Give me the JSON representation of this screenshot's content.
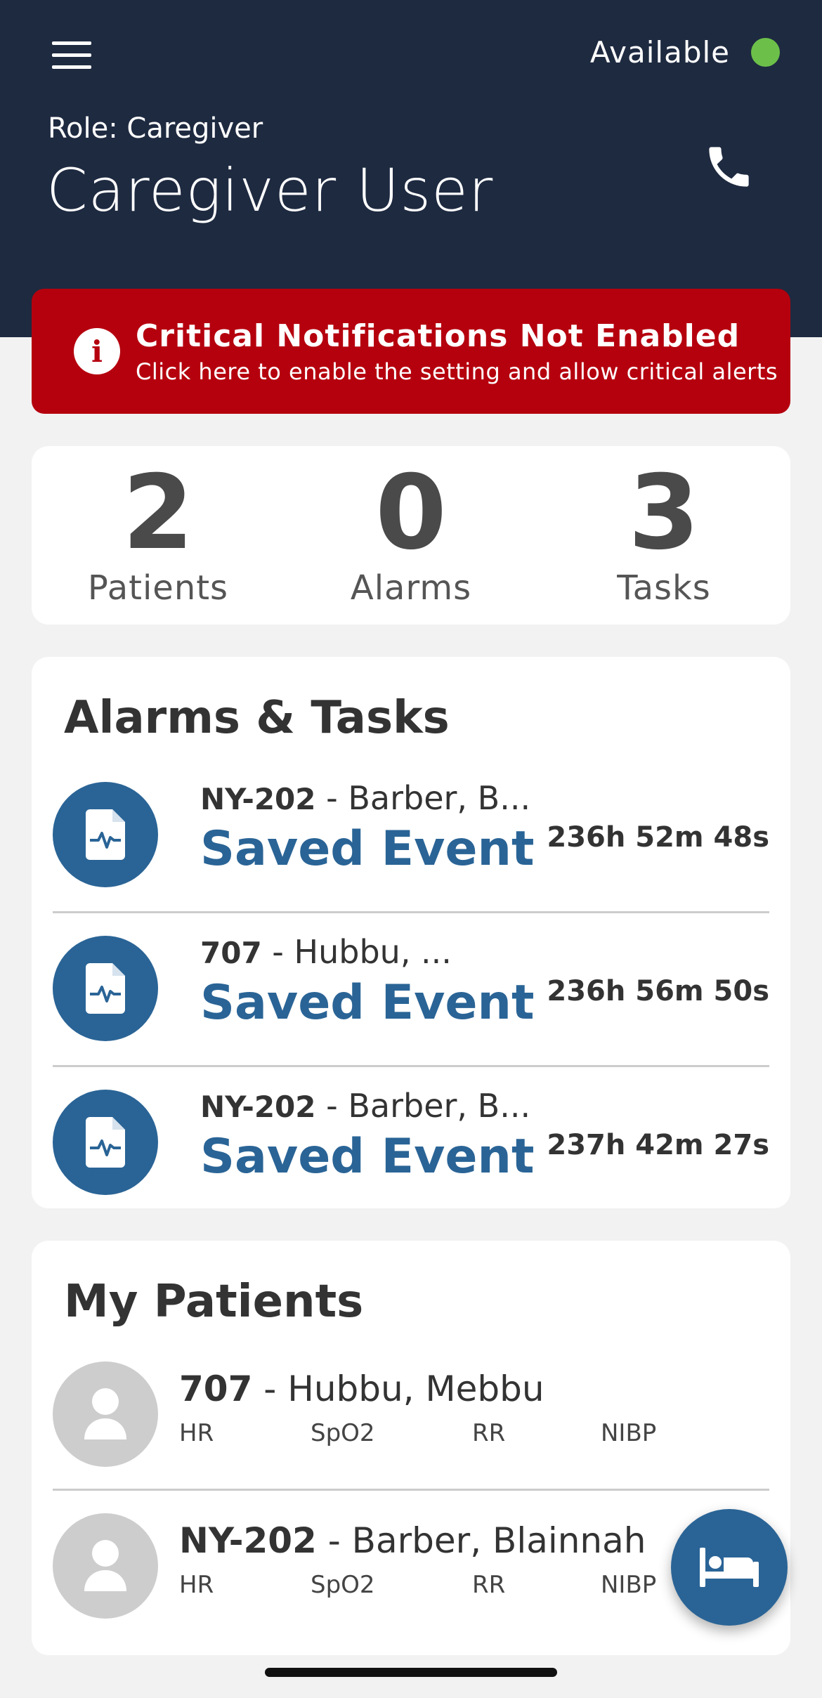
{
  "header": {
    "availability_label": "Available",
    "availability_color": "#6cc04a",
    "role_label": "Role: Caregiver",
    "user_name": "Caregiver User",
    "menu_icon": "hamburger-menu-icon",
    "call_icon": "phone-icon"
  },
  "critical_banner": {
    "title": "Critical Notifications Not Enabled",
    "subtitle": "Click here to enable the setting and allow critical alerts",
    "icon": "info-icon",
    "color": "#b5000e"
  },
  "summary": [
    {
      "value": "2",
      "label": "Patients"
    },
    {
      "value": "0",
      "label": "Alarms"
    },
    {
      "value": "3",
      "label": "Tasks"
    }
  ],
  "alarms_tasks": {
    "title": "Alarms & Tasks",
    "items": [
      {
        "room": "NY-202",
        "separator": " - ",
        "patient": "Barber, B...",
        "event": "Saved Event",
        "elapsed": "236h 52m 48s"
      },
      {
        "room": "707",
        "separator": " - ",
        "patient": "Hubbu, ...",
        "event": "Saved Event",
        "elapsed": "236h 56m 50s"
      },
      {
        "room": "NY-202",
        "separator": " - ",
        "patient": "Barber, B...",
        "event": "Saved Event",
        "elapsed": "237h 42m 27s"
      }
    ]
  },
  "my_patients": {
    "title": "My Patients",
    "items": [
      {
        "room": "707",
        "separator": " - ",
        "name": "Hubbu, Mebbu",
        "vitals": [
          "HR",
          "SpO2",
          "RR",
          "NIBP"
        ]
      },
      {
        "room": "NY-202",
        "separator": " - ",
        "name": "Barber, Blainnah",
        "vitals": [
          "HR",
          "SpO2",
          "RR",
          "NIBP"
        ]
      }
    ]
  },
  "fab": {
    "icon": "bed-icon"
  },
  "accent_color": "#2a6496"
}
